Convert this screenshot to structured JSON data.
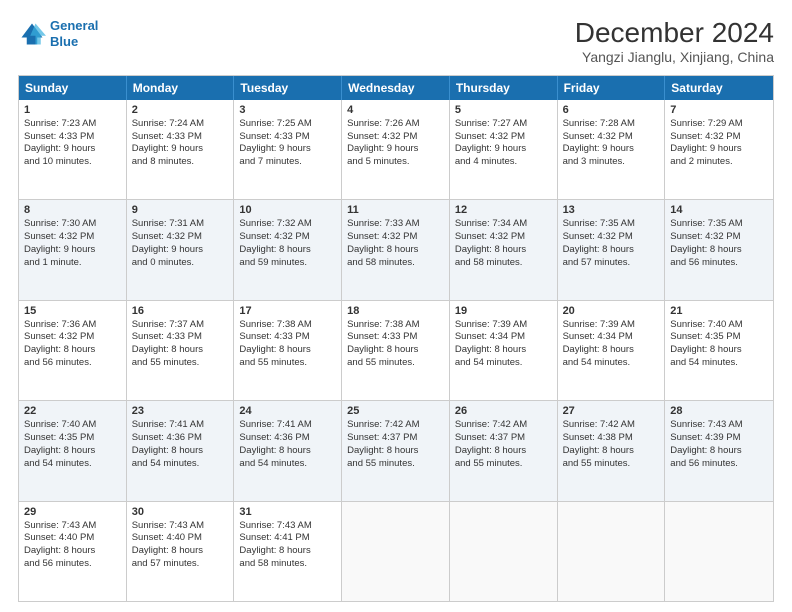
{
  "header": {
    "logo_line1": "General",
    "logo_line2": "Blue",
    "title": "December 2024",
    "subtitle": "Yangzi Jianglu, Xinjiang, China"
  },
  "days_of_week": [
    "Sunday",
    "Monday",
    "Tuesday",
    "Wednesday",
    "Thursday",
    "Friday",
    "Saturday"
  ],
  "rows": [
    {
      "alt": false,
      "cells": [
        {
          "day": "1",
          "lines": [
            "Sunrise: 7:23 AM",
            "Sunset: 4:33 PM",
            "Daylight: 9 hours",
            "and 10 minutes."
          ]
        },
        {
          "day": "2",
          "lines": [
            "Sunrise: 7:24 AM",
            "Sunset: 4:33 PM",
            "Daylight: 9 hours",
            "and 8 minutes."
          ]
        },
        {
          "day": "3",
          "lines": [
            "Sunrise: 7:25 AM",
            "Sunset: 4:33 PM",
            "Daylight: 9 hours",
            "and 7 minutes."
          ]
        },
        {
          "day": "4",
          "lines": [
            "Sunrise: 7:26 AM",
            "Sunset: 4:32 PM",
            "Daylight: 9 hours",
            "and 5 minutes."
          ]
        },
        {
          "day": "5",
          "lines": [
            "Sunrise: 7:27 AM",
            "Sunset: 4:32 PM",
            "Daylight: 9 hours",
            "and 4 minutes."
          ]
        },
        {
          "day": "6",
          "lines": [
            "Sunrise: 7:28 AM",
            "Sunset: 4:32 PM",
            "Daylight: 9 hours",
            "and 3 minutes."
          ]
        },
        {
          "day": "7",
          "lines": [
            "Sunrise: 7:29 AM",
            "Sunset: 4:32 PM",
            "Daylight: 9 hours",
            "and 2 minutes."
          ]
        }
      ]
    },
    {
      "alt": true,
      "cells": [
        {
          "day": "8",
          "lines": [
            "Sunrise: 7:30 AM",
            "Sunset: 4:32 PM",
            "Daylight: 9 hours",
            "and 1 minute."
          ]
        },
        {
          "day": "9",
          "lines": [
            "Sunrise: 7:31 AM",
            "Sunset: 4:32 PM",
            "Daylight: 9 hours",
            "and 0 minutes."
          ]
        },
        {
          "day": "10",
          "lines": [
            "Sunrise: 7:32 AM",
            "Sunset: 4:32 PM",
            "Daylight: 8 hours",
            "and 59 minutes."
          ]
        },
        {
          "day": "11",
          "lines": [
            "Sunrise: 7:33 AM",
            "Sunset: 4:32 PM",
            "Daylight: 8 hours",
            "and 58 minutes."
          ]
        },
        {
          "day": "12",
          "lines": [
            "Sunrise: 7:34 AM",
            "Sunset: 4:32 PM",
            "Daylight: 8 hours",
            "and 58 minutes."
          ]
        },
        {
          "day": "13",
          "lines": [
            "Sunrise: 7:35 AM",
            "Sunset: 4:32 PM",
            "Daylight: 8 hours",
            "and 57 minutes."
          ]
        },
        {
          "day": "14",
          "lines": [
            "Sunrise: 7:35 AM",
            "Sunset: 4:32 PM",
            "Daylight: 8 hours",
            "and 56 minutes."
          ]
        }
      ]
    },
    {
      "alt": false,
      "cells": [
        {
          "day": "15",
          "lines": [
            "Sunrise: 7:36 AM",
            "Sunset: 4:32 PM",
            "Daylight: 8 hours",
            "and 56 minutes."
          ]
        },
        {
          "day": "16",
          "lines": [
            "Sunrise: 7:37 AM",
            "Sunset: 4:33 PM",
            "Daylight: 8 hours",
            "and 55 minutes."
          ]
        },
        {
          "day": "17",
          "lines": [
            "Sunrise: 7:38 AM",
            "Sunset: 4:33 PM",
            "Daylight: 8 hours",
            "and 55 minutes."
          ]
        },
        {
          "day": "18",
          "lines": [
            "Sunrise: 7:38 AM",
            "Sunset: 4:33 PM",
            "Daylight: 8 hours",
            "and 55 minutes."
          ]
        },
        {
          "day": "19",
          "lines": [
            "Sunrise: 7:39 AM",
            "Sunset: 4:34 PM",
            "Daylight: 8 hours",
            "and 54 minutes."
          ]
        },
        {
          "day": "20",
          "lines": [
            "Sunrise: 7:39 AM",
            "Sunset: 4:34 PM",
            "Daylight: 8 hours",
            "and 54 minutes."
          ]
        },
        {
          "day": "21",
          "lines": [
            "Sunrise: 7:40 AM",
            "Sunset: 4:35 PM",
            "Daylight: 8 hours",
            "and 54 minutes."
          ]
        }
      ]
    },
    {
      "alt": true,
      "cells": [
        {
          "day": "22",
          "lines": [
            "Sunrise: 7:40 AM",
            "Sunset: 4:35 PM",
            "Daylight: 8 hours",
            "and 54 minutes."
          ]
        },
        {
          "day": "23",
          "lines": [
            "Sunrise: 7:41 AM",
            "Sunset: 4:36 PM",
            "Daylight: 8 hours",
            "and 54 minutes."
          ]
        },
        {
          "day": "24",
          "lines": [
            "Sunrise: 7:41 AM",
            "Sunset: 4:36 PM",
            "Daylight: 8 hours",
            "and 54 minutes."
          ]
        },
        {
          "day": "25",
          "lines": [
            "Sunrise: 7:42 AM",
            "Sunset: 4:37 PM",
            "Daylight: 8 hours",
            "and 55 minutes."
          ]
        },
        {
          "day": "26",
          "lines": [
            "Sunrise: 7:42 AM",
            "Sunset: 4:37 PM",
            "Daylight: 8 hours",
            "and 55 minutes."
          ]
        },
        {
          "day": "27",
          "lines": [
            "Sunrise: 7:42 AM",
            "Sunset: 4:38 PM",
            "Daylight: 8 hours",
            "and 55 minutes."
          ]
        },
        {
          "day": "28",
          "lines": [
            "Sunrise: 7:43 AM",
            "Sunset: 4:39 PM",
            "Daylight: 8 hours",
            "and 56 minutes."
          ]
        }
      ]
    },
    {
      "alt": false,
      "cells": [
        {
          "day": "29",
          "lines": [
            "Sunrise: 7:43 AM",
            "Sunset: 4:40 PM",
            "Daylight: 8 hours",
            "and 56 minutes."
          ]
        },
        {
          "day": "30",
          "lines": [
            "Sunrise: 7:43 AM",
            "Sunset: 4:40 PM",
            "Daylight: 8 hours",
            "and 57 minutes."
          ]
        },
        {
          "day": "31",
          "lines": [
            "Sunrise: 7:43 AM",
            "Sunset: 4:41 PM",
            "Daylight: 8 hours",
            "and 58 minutes."
          ]
        },
        {
          "day": "",
          "lines": []
        },
        {
          "day": "",
          "lines": []
        },
        {
          "day": "",
          "lines": []
        },
        {
          "day": "",
          "lines": []
        }
      ]
    }
  ]
}
